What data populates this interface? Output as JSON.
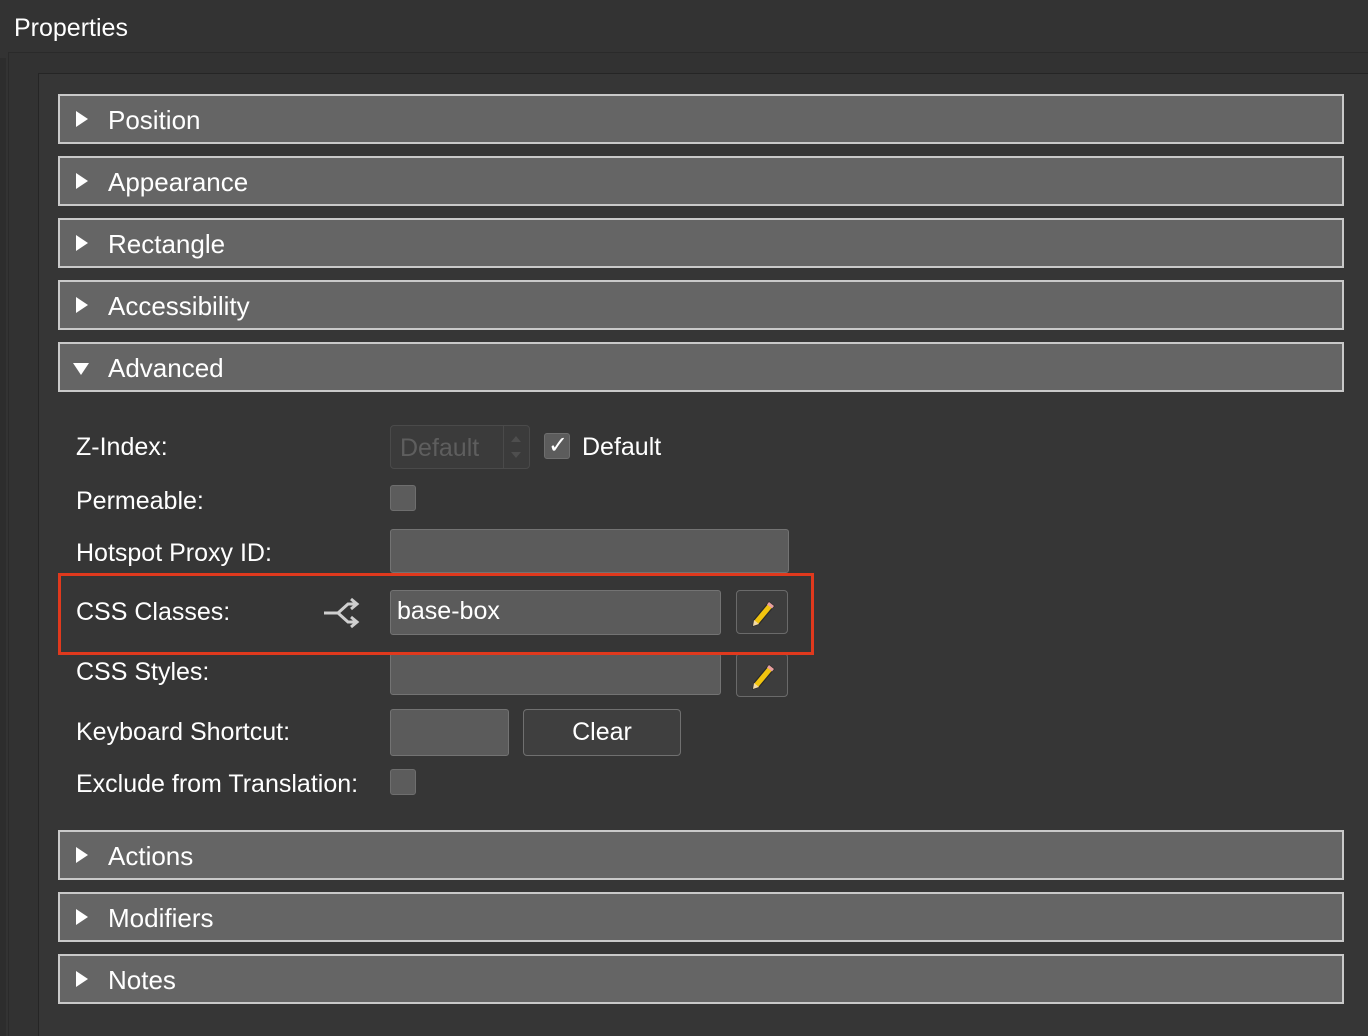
{
  "panel": {
    "title": "Properties"
  },
  "sections_top": [
    {
      "label": "Position",
      "expanded": false
    },
    {
      "label": "Appearance",
      "expanded": false
    },
    {
      "label": "Rectangle",
      "expanded": false
    },
    {
      "label": "Accessibility",
      "expanded": false
    },
    {
      "label": "Advanced",
      "expanded": true
    }
  ],
  "advanced": {
    "z_index": {
      "label": "Z-Index:",
      "value": "Default",
      "default_checked": true,
      "default_label": "Default"
    },
    "permeable": {
      "label": "Permeable:",
      "checked": false
    },
    "hotspot_proxy_id": {
      "label": "Hotspot Proxy ID:",
      "value": ""
    },
    "css_classes": {
      "label": "CSS Classes:",
      "value": "base-box",
      "icon": "branch-arrows-icon",
      "edit_icon": "pencil-icon"
    },
    "css_styles": {
      "label": "CSS Styles:",
      "value": "",
      "edit_icon": "pencil-icon"
    },
    "keyboard_shortcut": {
      "label": "Keyboard Shortcut:",
      "value": "",
      "clear_label": "Clear"
    },
    "exclude_translation": {
      "label": "Exclude from Translation:",
      "checked": false
    }
  },
  "sections_bottom": [
    {
      "label": "Actions",
      "expanded": false
    },
    {
      "label": "Modifiers",
      "expanded": false
    },
    {
      "label": "Notes",
      "expanded": false
    }
  ],
  "colors": {
    "highlight": "#e0391d",
    "header_bg": "#656565",
    "panel_bg": "#363636"
  }
}
